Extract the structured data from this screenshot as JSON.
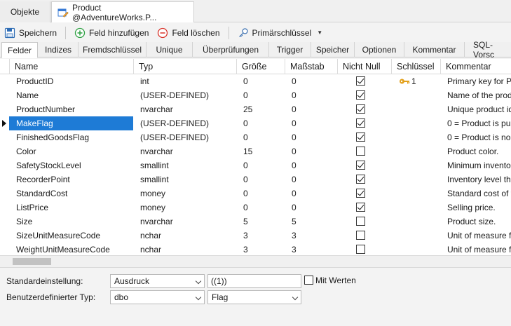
{
  "doc_tabs": {
    "objects_label": "Objekte",
    "product_label": "Product @AdventureWorks.P..."
  },
  "toolbar": {
    "save_label": "Speichern",
    "add_field_label": "Feld hinzufügen",
    "delete_field_label": "Feld löschen",
    "primary_key_label": "Primärschlüssel"
  },
  "sub_tabs": [
    "Felder",
    "Indizes",
    "Fremdschlüssel",
    "Unique",
    "Überprüfungen",
    "Trigger",
    "Speicher",
    "Optionen",
    "Kommentar",
    "SQL-Vorsc"
  ],
  "grid": {
    "columns": [
      "Name",
      "Typ",
      "Größe",
      "Maßstab",
      "Nicht Null",
      "Schlüssel",
      "Kommentar"
    ],
    "rows": [
      {
        "name": "ProductID",
        "type": "int",
        "size": "0",
        "scale": "0",
        "notnull": true,
        "key": "1",
        "comment": "Primary key for Pr"
      },
      {
        "name": "Name",
        "type": "(USER-DEFINED)",
        "size": "0",
        "scale": "0",
        "notnull": true,
        "key": "",
        "comment": "Name of the prod"
      },
      {
        "name": "ProductNumber",
        "type": "nvarchar",
        "size": "25",
        "scale": "0",
        "notnull": true,
        "key": "",
        "comment": "Unique product id"
      },
      {
        "name": "MakeFlag",
        "type": "(USER-DEFINED)",
        "size": "0",
        "scale": "0",
        "notnull": true,
        "key": "",
        "comment": "0 = Product is pur"
      },
      {
        "name": "FinishedGoodsFlag",
        "type": "(USER-DEFINED)",
        "size": "0",
        "scale": "0",
        "notnull": true,
        "key": "",
        "comment": "0 = Product is no"
      },
      {
        "name": "Color",
        "type": "nvarchar",
        "size": "15",
        "scale": "0",
        "notnull": false,
        "key": "",
        "comment": "Product color."
      },
      {
        "name": "SafetyStockLevel",
        "type": "smallint",
        "size": "0",
        "scale": "0",
        "notnull": true,
        "key": "",
        "comment": "Minimum invento"
      },
      {
        "name": "RecorderPoint",
        "type": "smallint",
        "size": "0",
        "scale": "0",
        "notnull": true,
        "key": "",
        "comment": "Inventory level th"
      },
      {
        "name": "StandardCost",
        "type": "money",
        "size": "0",
        "scale": "0",
        "notnull": true,
        "key": "",
        "comment": "Standard cost of t"
      },
      {
        "name": "ListPrice",
        "type": "money",
        "size": "0",
        "scale": "0",
        "notnull": true,
        "key": "",
        "comment": "Selling price."
      },
      {
        "name": "Size",
        "type": "nvarchar",
        "size": "5",
        "scale": "5",
        "notnull": false,
        "key": "",
        "comment": "Product size."
      },
      {
        "name": "SizeUnitMeasureCode",
        "type": "nchar",
        "size": "3",
        "scale": "3",
        "notnull": false,
        "key": "",
        "comment": "Unit of measure fo"
      },
      {
        "name": "WeightUnitMeasureCode",
        "type": "nchar",
        "size": "3",
        "scale": "3",
        "notnull": false,
        "key": "",
        "comment": "Unit of measure fo"
      }
    ]
  },
  "bottom": {
    "default_label": "Standardeinstellung:",
    "default_select": "Ausdruck",
    "default_value": "((1))",
    "with_values_label": "Mit Werten",
    "custom_type_label": "Benutzerdefinierter Typ:",
    "schema_select": "dbo",
    "type_select": "Flag"
  },
  "colors": {
    "selection": "#1e7bd6",
    "add_icon": "#2ea043",
    "delete_icon": "#d9342b",
    "key_icon": "#e3a01b"
  }
}
